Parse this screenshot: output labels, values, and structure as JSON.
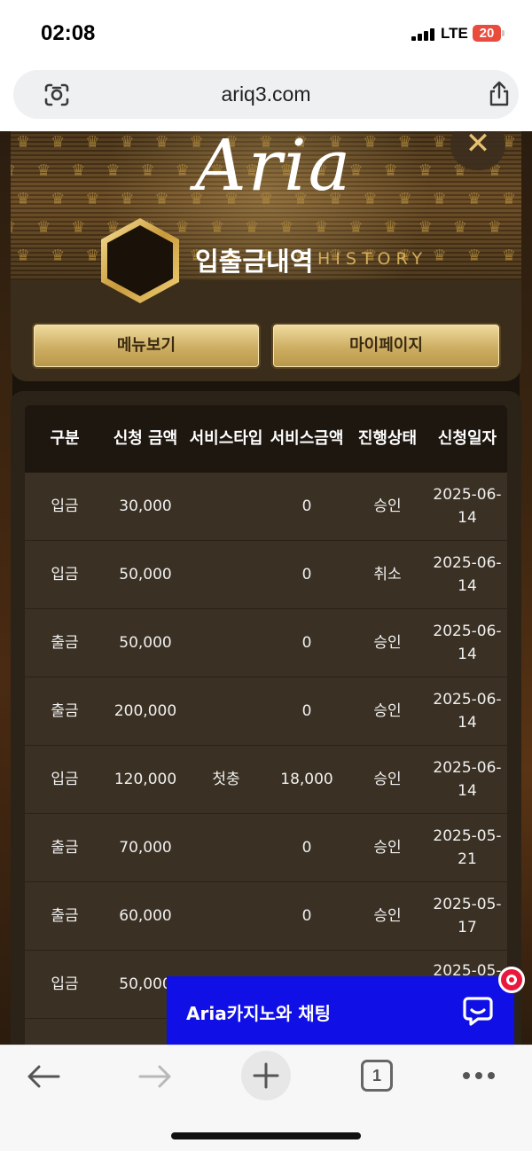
{
  "status_bar": {
    "time": "02:08",
    "network": "LTE",
    "battery": "20"
  },
  "browser": {
    "url": "ariq3.com",
    "icons": [
      "lens-icon",
      "share-icon"
    ]
  },
  "header": {
    "logo": "Aria",
    "title": "입출금내역",
    "subtitle": "HISTORY",
    "close_icon": "close-icon",
    "buttons": {
      "menu": "메뉴보기",
      "mypage": "마이페이지"
    }
  },
  "table": {
    "headers": [
      "구분",
      "신청 금액",
      "서비스타입",
      "서비스금액",
      "진행상태",
      "신청일자"
    ],
    "rows": [
      [
        "입금",
        "30,000",
        "",
        "0",
        "승인",
        "2025-06-14"
      ],
      [
        "입금",
        "50,000",
        "",
        "0",
        "취소",
        "2025-06-14"
      ],
      [
        "출금",
        "50,000",
        "",
        "0",
        "승인",
        "2025-06-14"
      ],
      [
        "출금",
        "200,000",
        "",
        "0",
        "승인",
        "2025-06-14"
      ],
      [
        "입금",
        "120,000",
        "첫충",
        "18,000",
        "승인",
        "2025-06-14"
      ],
      [
        "출금",
        "70,000",
        "",
        "0",
        "승인",
        "2025-05-21"
      ],
      [
        "출금",
        "60,000",
        "",
        "0",
        "승인",
        "2025-05-17"
      ],
      [
        "입금",
        "50,000",
        "",
        "",
        "",
        "2025-05-"
      ]
    ]
  },
  "chat": {
    "label": "Aria카지노와 채팅",
    "icon": "chat-bubble-icon"
  },
  "toolbar": {
    "tab_count": "1",
    "icons": [
      "back-icon",
      "forward-icon",
      "new-tab-icon",
      "tabs-icon",
      "more-icon"
    ]
  },
  "colors": {
    "accent_gold": "#d4ad5a",
    "table_bg": "#3a3023",
    "chat_blue": "#1010e6",
    "badge_red": "#e8193c"
  }
}
